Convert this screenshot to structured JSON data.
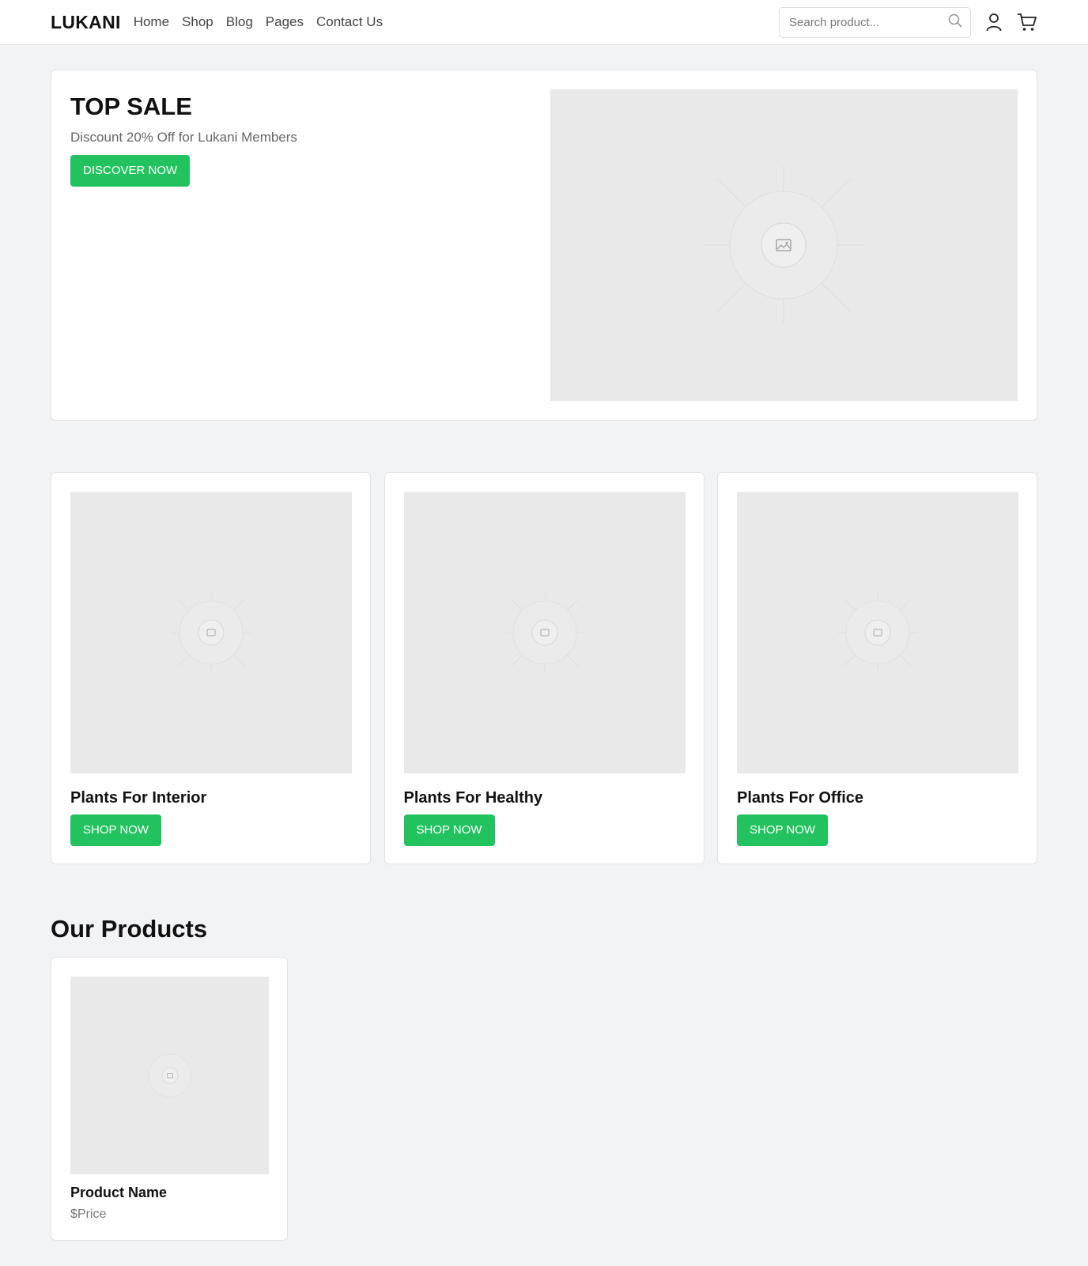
{
  "header": {
    "logo": "LUKANI",
    "nav": [
      "Home",
      "Shop",
      "Blog",
      "Pages",
      "Contact Us"
    ],
    "search_placeholder": "Search product...",
    "icons": [
      "search-icon",
      "user-icon",
      "cart-icon"
    ]
  },
  "hero": {
    "title": "TOP SALE",
    "subtitle": "Discount 20% Off for Lukani Members",
    "button": "DISCOVER NOW"
  },
  "categories": [
    {
      "title": "Plants For Interior",
      "button": "SHOP NOW"
    },
    {
      "title": "Plants For Healthy",
      "button": "SHOP NOW"
    },
    {
      "title": "Plants For Office",
      "button": "SHOP NOW"
    }
  ],
  "products_section": {
    "title": "Our Products",
    "items": [
      {
        "name": "Product Name",
        "price": "$Price"
      }
    ]
  },
  "colors": {
    "accent": "#22c35e",
    "background": "#f2f3f5",
    "placeholder": "#e9e9e9"
  }
}
